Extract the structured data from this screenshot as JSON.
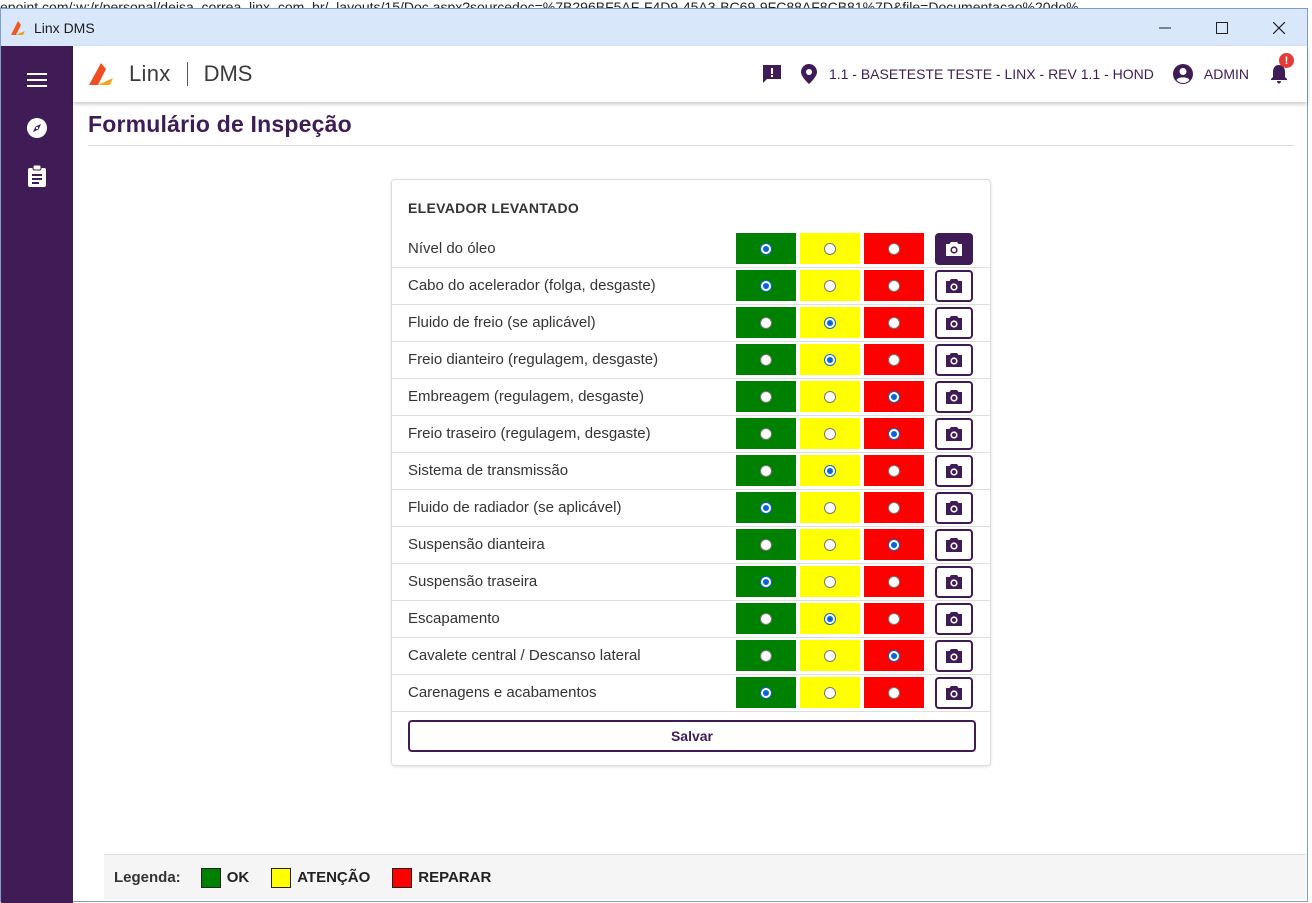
{
  "browser_url": "epoint.com/:w:/r/personal/deisa_correa_linx_com_br/_layouts/15/Doc.aspx?sourcedoc=%7B296BF5AF-F4D9-45A3-BC69-9FC88AF8CB81%7D&file=Documentacao%20do%",
  "window": {
    "title": "Linx DMS"
  },
  "header": {
    "brand_linx": "Linx",
    "brand_dms": "DMS",
    "location": "1.1 - BASETESTE TESTE - LINX - REV 1.1 - HOND",
    "user": "ADMIN",
    "notification_badge": "!"
  },
  "page": {
    "title": "Formulário de Inspeção"
  },
  "form": {
    "section_title": "ELEVADOR LEVANTADO",
    "save_label": "Salvar",
    "items": [
      {
        "label": "Nível do óleo",
        "selected": "ok"
      },
      {
        "label": "Cabo do acelerador (folga, desgaste)",
        "selected": "ok"
      },
      {
        "label": "Fluido de freio (se aplicável)",
        "selected": "atencao"
      },
      {
        "label": "Freio dianteiro (regulagem, desgaste)",
        "selected": "atencao"
      },
      {
        "label": "Embreagem (regulagem, desgaste)",
        "selected": "reparar"
      },
      {
        "label": "Freio traseiro (regulagem, desgaste)",
        "selected": "reparar"
      },
      {
        "label": "Sistema de transmissão",
        "selected": "atencao"
      },
      {
        "label": "Fluido de radiador (se aplicável)",
        "selected": "ok"
      },
      {
        "label": "Suspensão dianteira",
        "selected": "reparar"
      },
      {
        "label": "Suspensão traseira",
        "selected": "ok"
      },
      {
        "label": "Escapamento",
        "selected": "atencao"
      },
      {
        "label": "Cavalete central / Descanso lateral",
        "selected": "reparar"
      },
      {
        "label": "Carenagens e acabamentos",
        "selected": "ok"
      }
    ]
  },
  "legend": {
    "title": "Legenda:",
    "items": [
      {
        "label": "OK",
        "color": "#008000"
      },
      {
        "label": "ATENÇÃO",
        "color": "#ffff00"
      },
      {
        "label": "REPARAR",
        "color": "#ff0000"
      }
    ]
  },
  "colors": {
    "brand_purple": "#3f1c55",
    "radio_blue": "#0a64d6"
  }
}
